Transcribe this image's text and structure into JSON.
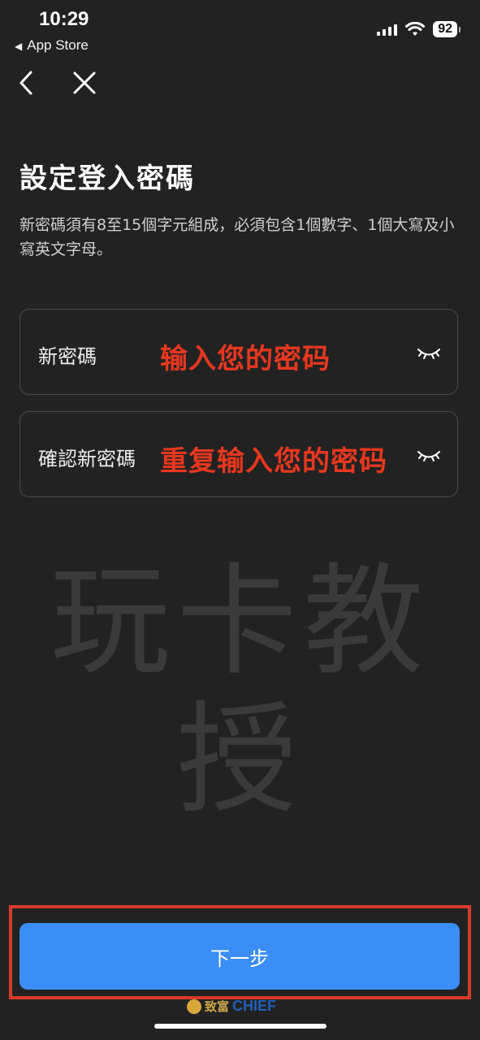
{
  "status_bar": {
    "time": "10:29",
    "back_app": "App Store",
    "battery": "92"
  },
  "page": {
    "title": "設定登入密碼",
    "description": "新密碼須有8至15個字元組成，必須包含1個數字、1個大寫及小寫英文字母。"
  },
  "fields": {
    "new_password": {
      "label": "新密碼",
      "hint_overlay": "输入您的密码"
    },
    "confirm_password": {
      "label": "確認新密碼",
      "hint_overlay": "重复输入您的密码"
    }
  },
  "watermark": "玩卡教授",
  "actions": {
    "next_label": "下一步"
  },
  "brand": {
    "cn": "致富",
    "en": "CHIEF"
  },
  "colors": {
    "background": "#222222",
    "accent": "#3a8ef5",
    "annotation": "#e8371f"
  }
}
